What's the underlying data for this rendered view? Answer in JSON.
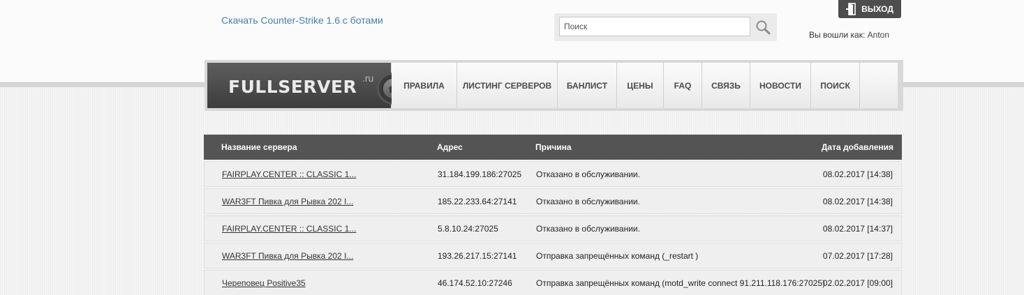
{
  "header": {
    "download_link": "Скачать Counter-Strike 1.6 с ботами",
    "search_placeholder": "Поиск",
    "search_value": "",
    "logout_label": "ВЫХОД",
    "logged_in_prefix": "Вы вошли как:",
    "username": "Anton"
  },
  "logo": {
    "text": "FULLSERVER",
    "sup": ".ru"
  },
  "nav": {
    "items": [
      {
        "label": "ПРАВИЛА"
      },
      {
        "label": "ЛИСТИНГ СЕРВЕРОВ"
      },
      {
        "label": "БАНЛИСТ"
      },
      {
        "label": "ЦЕНЫ"
      },
      {
        "label": "FAQ"
      },
      {
        "label": "СВЯЗЬ"
      },
      {
        "label": "НОВОСТИ"
      },
      {
        "label": "ПОИСК"
      }
    ]
  },
  "table": {
    "headers": {
      "name": "Название сервера",
      "address": "Адрес",
      "reason": "Причина",
      "date": "Дата добавления"
    },
    "rows": [
      {
        "name": "FAIRPLAY.CENTER :: CLASSIC 1...",
        "address": "31.184.199.186:27025",
        "reason": "Отказано в обслуживании.",
        "date": "08.02.2017 [14:38]"
      },
      {
        "name": "WAR3FT Пивка для Рывка 202 I...",
        "address": "185.22.233.64:27141",
        "reason": "Отказано в обслуживании.",
        "date": "08.02.2017 [14:38]"
      },
      {
        "name": "FAIRPLAY.CENTER :: CLASSIC 1...",
        "address": "5.8.10.24:27025",
        "reason": "Отказано в обслуживании.",
        "date": "08.02.2017 [14:37]"
      },
      {
        "name": "WAR3FT Пивка для Рывка 202 I...",
        "address": "193.26.217.15:27141",
        "reason": "Отправка запрещённых команд (_restart )",
        "date": "07.02.2017 [17:28]"
      },
      {
        "name": "Череповец Positive35",
        "address": "46.174.52.10:27246",
        "reason": "Отправка запрещённых команд (motd_write connect 91.211.118.176:27025)",
        "date": "02.02.2017 [09:00]"
      }
    ]
  },
  "colors": {
    "link": "#4a7ea8",
    "header_bg": "#545454",
    "logo_bg": "#4a4a4a",
    "row_bg": "#efefef"
  }
}
